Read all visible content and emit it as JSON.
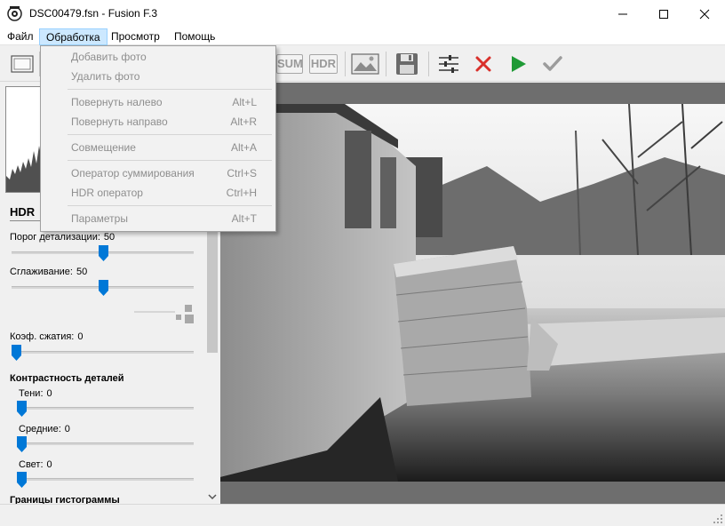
{
  "window": {
    "title": "DSC00479.fsn - Fusion F.3",
    "app_icon": "app-logo-icon",
    "controls": [
      "minimize-icon",
      "maximize-icon",
      "close-icon"
    ]
  },
  "menu": {
    "items": [
      {
        "label": "Файл"
      },
      {
        "label": "Обработка",
        "active": true
      },
      {
        "label": "Просмотр"
      },
      {
        "label": "Помощь"
      }
    ]
  },
  "dropdown": {
    "items": [
      {
        "label": "Добавить фото",
        "shortcut": ""
      },
      {
        "label": "Удалить фото",
        "shortcut": ""
      },
      {
        "label": "Повернуть налево",
        "shortcut": "Alt+L"
      },
      {
        "label": "Повернуть направо",
        "shortcut": "Alt+R"
      },
      {
        "label": "Совмещение",
        "shortcut": "Alt+A"
      },
      {
        "label": "Оператор суммирования",
        "shortcut": "Ctrl+S"
      },
      {
        "label": "HDR оператор",
        "shortcut": "Ctrl+H"
      },
      {
        "label": "Параметры",
        "shortcut": "Alt+T"
      }
    ]
  },
  "toolbar": {
    "sum_label": "SUM",
    "hdr_label": "HDR",
    "icons": [
      "frame-icon",
      "image-icon",
      "save-icon",
      "settings-sliders-icon",
      "cancel-x-icon",
      "run-play-icon",
      "apply-check-icon"
    ],
    "colors": {
      "cancel": "#d9302b",
      "run": "#1f9a36",
      "apply": "#9c9c9c"
    }
  },
  "panel": {
    "title": "HDR",
    "detail_threshold": {
      "label": "Порог детализации:",
      "value": "50",
      "level": 0.5
    },
    "smoothing": {
      "label": "Сглаживание:",
      "value": "50",
      "level": 0.5
    },
    "compression": {
      "label": "Коэф. сжатия:",
      "value": "0",
      "level": 0.0
    },
    "detail_contrast_title": "Контрастность деталей",
    "shadows": {
      "label": "Тени:",
      "value": "0",
      "level": 0.0
    },
    "midtones": {
      "label": "Средние:",
      "value": "0",
      "level": 0.0
    },
    "lights": {
      "label": "Свет:",
      "value": "0",
      "level": 0.0
    },
    "histogram_bounds_title": "Границы гистограммы"
  },
  "colors": {
    "accent": "#0078d7",
    "menu_active_bg": "#cce8ff",
    "image_bg": "#6e6e6e"
  }
}
